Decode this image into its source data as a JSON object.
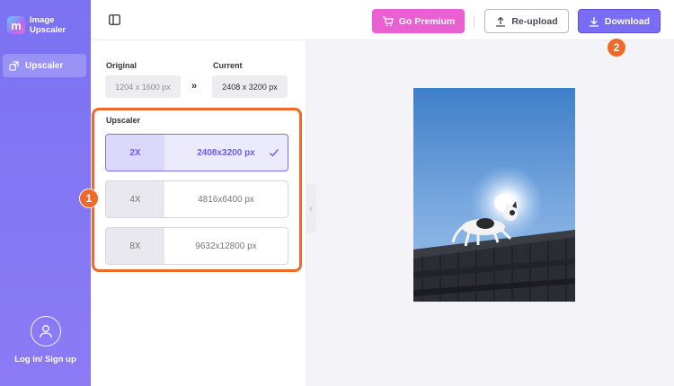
{
  "app": {
    "name": "Image Upscaler",
    "logo_glyph": "m"
  },
  "sidebar": {
    "items": [
      {
        "label": "Upscaler",
        "icon": "upscale-icon"
      }
    ],
    "account_label": "Log in/ Sign up"
  },
  "toolbar": {
    "premium_label": "Go Premium",
    "reupload_label": "Re-upload",
    "download_label": "Download"
  },
  "sizes": {
    "original_label": "Original",
    "original_value": "1204 x 1600 px",
    "current_label": "Current",
    "current_value": "2408 x 3200 px",
    "arrow": "»"
  },
  "upscaler": {
    "title": "Upscaler",
    "options": [
      {
        "scale": "2X",
        "resolution": "2408x3200 px",
        "selected": true
      },
      {
        "scale": "4X",
        "resolution": "4816x6400 px",
        "selected": false
      },
      {
        "scale": "8X",
        "resolution": "9632x12800 px",
        "selected": false
      }
    ]
  },
  "annotations": {
    "badge_1": "1",
    "badge_2": "2"
  },
  "colors": {
    "sidebar": "#7b72f2",
    "accent": "#7a6df3",
    "premium": "#ea5fd2",
    "highlight": "#ee6a2a"
  }
}
